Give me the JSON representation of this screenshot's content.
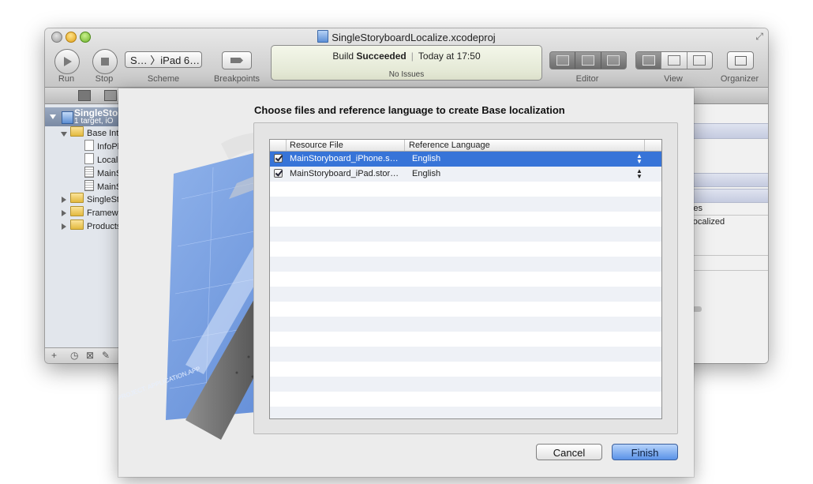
{
  "window": {
    "title": "SingleStoryboardLocalize.xcodeproj"
  },
  "toolbar": {
    "run_label": "Run",
    "stop_label": "Stop",
    "scheme_label": "Scheme",
    "scheme_value": "S…  〉iPad 6…",
    "breakpoints_label": "Breakpoints",
    "editor_label": "Editor",
    "view_label": "View",
    "organizer_label": "Organizer"
  },
  "activity": {
    "status_prefix": "Build",
    "status_bold": "Succeeded",
    "time": "Today at 17:50",
    "issues": "No Issues"
  },
  "navigator": {
    "project_name": "SingleStory",
    "project_sub": "1 target, iO",
    "items": [
      {
        "label": "Base Int"
      },
      {
        "label": "InfoPl"
      },
      {
        "label": "Locali"
      },
      {
        "label": "MainS"
      },
      {
        "label": "MainS"
      },
      {
        "label": "SingleSto"
      },
      {
        "label": "Framew"
      },
      {
        "label": "Products"
      }
    ]
  },
  "inspector": {
    "line1": "ources",
    "line2": "es Localized"
  },
  "sheet": {
    "title": "Choose files and reference language to create Base localization",
    "columns": {
      "resource_file": "Resource File",
      "reference_language": "Reference Language"
    },
    "rows": [
      {
        "file": "MainStoryboard_iPhone.s…",
        "language": "English",
        "checked": true,
        "selected": true
      },
      {
        "file": "MainStoryboard_iPad.stor…",
        "language": "English",
        "checked": true,
        "selected": false
      }
    ],
    "cancel_label": "Cancel",
    "finish_label": "Finish",
    "blueprint_text": "PROJECT: APPLICATION.APP"
  },
  "colors": {
    "selection": "#3774d8",
    "finish_button": "#5a92e8",
    "blueprint": "#4a7fd6"
  }
}
